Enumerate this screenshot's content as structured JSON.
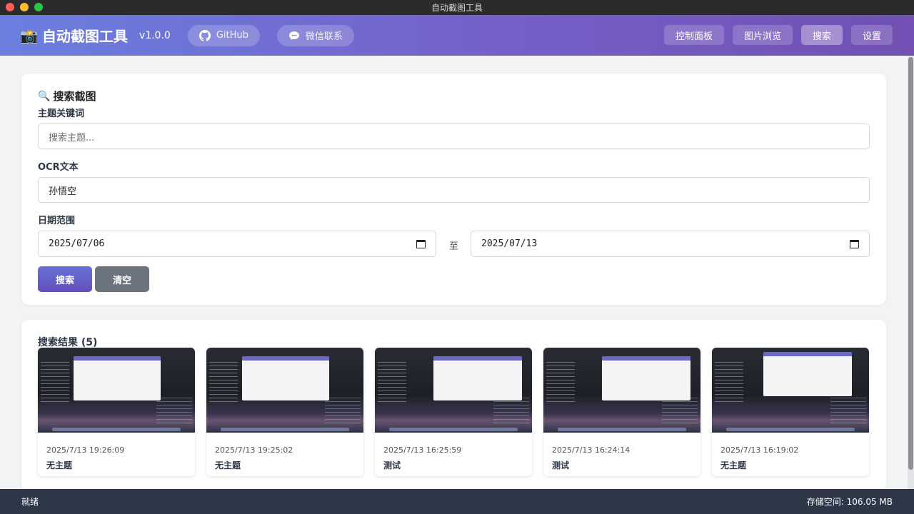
{
  "window": {
    "title": "自动截图工具"
  },
  "header": {
    "brand_icon": "📸",
    "brand_title": "自动截图工具",
    "version": "v1.0.0",
    "github_label": "GitHub",
    "wechat_label": "微信联系",
    "nav": [
      {
        "label": "控制面板",
        "active": false
      },
      {
        "label": "图片浏览",
        "active": false
      },
      {
        "label": "搜索",
        "active": true
      },
      {
        "label": "设置",
        "active": false
      }
    ]
  },
  "search": {
    "title_icon": "🔍",
    "title": "搜索截图",
    "topic_label": "主题关键词",
    "topic_placeholder": "搜索主题...",
    "topic_value": "",
    "ocr_label": "OCR文本",
    "ocr_value": "孙悟空",
    "date_label": "日期范围",
    "date_from": "2025/07/06",
    "date_to": "2025/07/13",
    "to_label": "至",
    "search_button": "搜索",
    "clear_button": "清空"
  },
  "results": {
    "title": "搜索结果 (5)",
    "items": [
      {
        "time": "2025/7/13 19:26:09",
        "topic": "无主题"
      },
      {
        "time": "2025/7/13 19:25:02",
        "topic": "无主题"
      },
      {
        "time": "2025/7/13 16:25:59",
        "topic": "测试"
      },
      {
        "time": "2025/7/13 16:24:14",
        "topic": "测试"
      },
      {
        "time": "2025/7/13 16:19:02",
        "topic": "无主题"
      }
    ]
  },
  "status": {
    "left": "就绪",
    "right": "存储空间: 106.05 MB"
  },
  "colors": {
    "header_gradient_start": "#6a7fe0",
    "header_gradient_end": "#7250b4",
    "primary_button": "#6050b8",
    "secondary_button": "#6c7480",
    "status_bar": "#2d3748"
  }
}
